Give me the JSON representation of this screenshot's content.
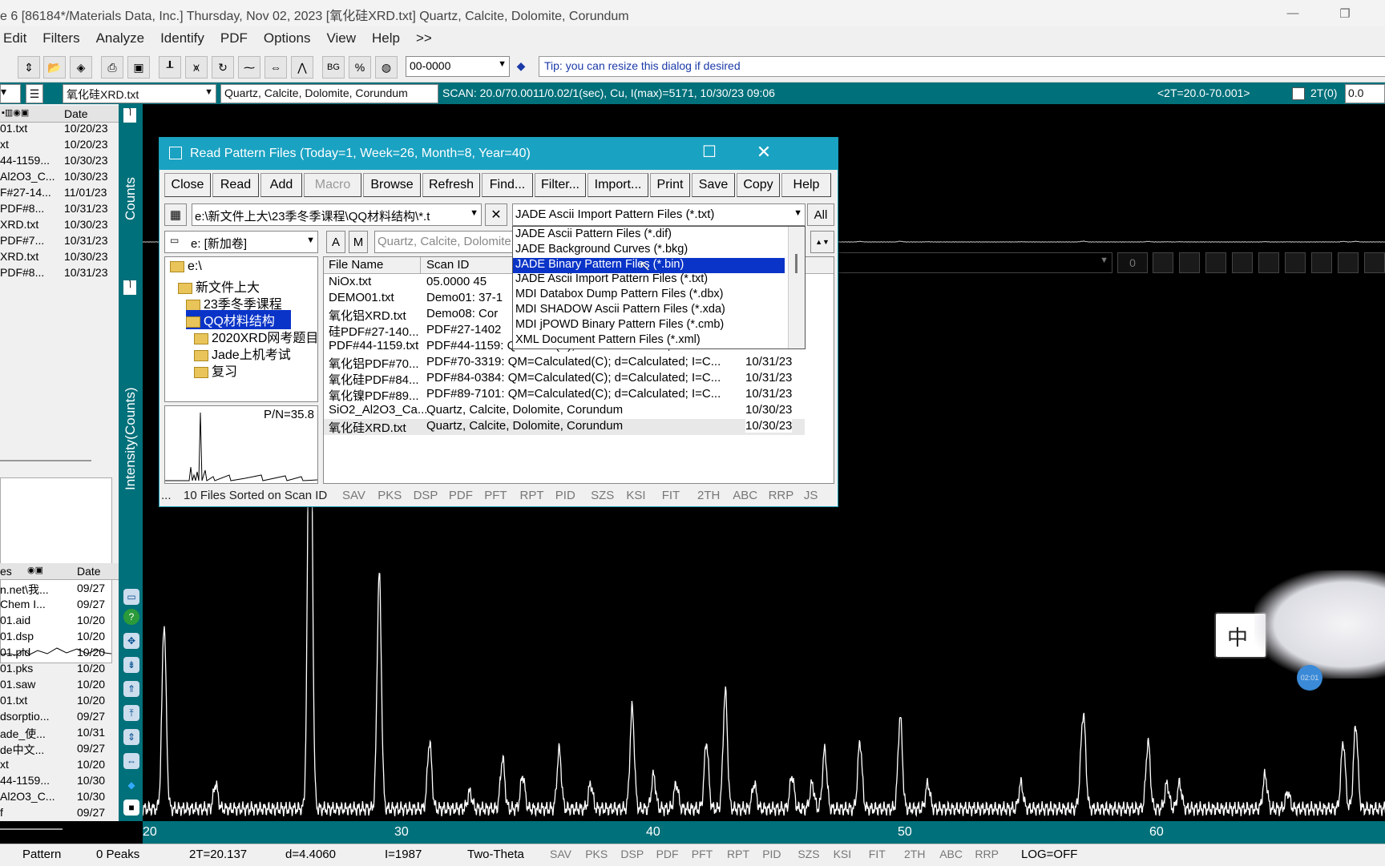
{
  "window": {
    "title": "e 6 [86184*/Materials Data, Inc.] Thursday, Nov 02, 2023 [氧化硅XRD.txt] Quartz, Calcite, Dolomite, Corundum",
    "minimize": "—",
    "restore": "❐"
  },
  "menu": [
    "Edit",
    "Filters",
    "Analyze",
    "Identify",
    "PDF",
    "Options",
    "View",
    "Help",
    ">>"
  ],
  "toolbar": {
    "pdf_number": "00-0000",
    "tip": "Tip: you can resize this dialog if desired",
    "icons": [
      "up-down-arrows-icon",
      "open-folder-icon",
      "clear-icon",
      "print-icon",
      "save-disk-icon",
      "bar-chart-icon",
      "peak-search-icon",
      "rotate-icon",
      "smooth-icon",
      "zoom-arrows-icon",
      "peak-icon",
      "bg-icon",
      "percent-icon",
      "globe-icon"
    ],
    "bg_label": "BG",
    "percent_label": "%"
  },
  "infobar": {
    "file": "氧化硅XRD.txt",
    "phases": "Quartz, Calcite, Dolomite, Corundum",
    "scan": "SCAN: 20.0/70.0011/0.02/1(sec), Cu, I(max)=5171, 10/30/23 09:06",
    "range": "<2T=20.0-70.001>",
    "twotheta_label": "2T(0)",
    "twotheta_value": "0.0"
  },
  "left_panel": {
    "header": "Date",
    "top_files": [
      {
        "name": "01.txt",
        "date": "10/20/23"
      },
      {
        "name": "xt",
        "date": "10/20/23"
      },
      {
        "name": "44-1159...",
        "date": "10/30/23"
      },
      {
        "name": "Al2O3_C...",
        "date": "10/30/23"
      },
      {
        "name": "F#27-14...",
        "date": "11/01/23"
      },
      {
        "name": "PDF#8...",
        "date": "10/31/23"
      },
      {
        "name": "XRD.txt",
        "date": "10/30/23"
      },
      {
        "name": "PDF#7...",
        "date": "10/31/23"
      },
      {
        "name": "XRD.txt",
        "date": "10/30/23"
      },
      {
        "name": "PDF#8...",
        "date": "10/31/23"
      }
    ],
    "bottom_header_name": "es",
    "bottom_header_date": "Date",
    "bottom_files": [
      {
        "name": "n.net\\我...",
        "date": "09/27"
      },
      {
        "name": "Chem I...",
        "date": "09/27"
      },
      {
        "name": "01.aid",
        "date": "10/20"
      },
      {
        "name": "01.dsp",
        "date": "10/20"
      },
      {
        "name": "01.pid",
        "date": "10/20"
      },
      {
        "name": "01.pks",
        "date": "10/20"
      },
      {
        "name": "01.saw",
        "date": "10/20"
      },
      {
        "name": "01.txt",
        "date": "10/20"
      },
      {
        "name": "dsorptio...",
        "date": "09/27"
      },
      {
        "name": "ade_使...",
        "date": "10/31"
      },
      {
        "name": "de中文...",
        "date": "09/27"
      },
      {
        "name": "xt",
        "date": "10/20"
      },
      {
        "name": "44-1159...",
        "date": "10/30"
      },
      {
        "name": "Al2O3_C...",
        "date": "10/30"
      },
      {
        "name": "f",
        "date": "09/27"
      }
    ]
  },
  "side_labels": {
    "counts": "Counts",
    "intensity": "Intensity(Counts)"
  },
  "plot": {
    "x_ticks": [
      "20",
      "30",
      "40",
      "50",
      "60"
    ],
    "x_range": [
      20,
      70
    ],
    "mini_value": "0",
    "badge": "02:01"
  },
  "dialog": {
    "title": "Read Pattern Files (Today=1, Week=26, Month=8, Year=40)",
    "buttons": [
      "Close",
      "Read",
      "Add",
      "Macro",
      "Browse",
      "Refresh",
      "Find...",
      "Filter...",
      "Import...",
      "Print",
      "Save",
      "Copy",
      "Help"
    ],
    "path": "e:\\新文件上大\\23季冬季课程\\QQ材料结构\\*.t",
    "filter_selected": "JADE Ascii Import Pattern Files (*.txt)",
    "all_label": "All",
    "drive": "e: [新加卷]",
    "a_label": "A",
    "m_label": "M",
    "scan_filter": "Quartz, Calcite, Dolomite",
    "tree": [
      {
        "label": "e:\\",
        "level": 0
      },
      {
        "label": "新文件上大",
        "level": 1
      },
      {
        "label": "23季冬季课程",
        "level": 2
      },
      {
        "label": "QQ材料结构",
        "level": 2,
        "selected": true
      },
      {
        "label": "2020XRD网考题目",
        "level": 3
      },
      {
        "label": "Jade上机考试",
        "level": 3
      },
      {
        "label": "复习",
        "level": 3
      }
    ],
    "pn": "P/N=35.8",
    "columns": {
      "name": "File Name",
      "scan": "Scan ID"
    },
    "files": [
      {
        "name": "NiOx.txt",
        "scan": "05.0000   45",
        "date": ""
      },
      {
        "name": "DEMO01.txt",
        "scan": "Demo01: 37-1",
        "date": ""
      },
      {
        "name": "氧化铝XRD.txt",
        "scan": "Demo08: Cor",
        "date": ""
      },
      {
        "name": "硅PDF#27-140...",
        "scan": "PDF#27-1402",
        "date": ""
      },
      {
        "name": "PDF#44-1159.txt",
        "scan": "PDF#44-1159: QM=Star(S); d=Diffractometer; I=Diff...",
        "date": "10/30/23"
      },
      {
        "name": "氧化铝PDF#70...",
        "scan": "PDF#70-3319: QM=Calculated(C); d=Calculated; I=C...",
        "date": "10/31/23"
      },
      {
        "name": "氧化硅PDF#84...",
        "scan": "PDF#84-0384: QM=Calculated(C); d=Calculated; I=C...",
        "date": "10/31/23"
      },
      {
        "name": "氧化镍PDF#89...",
        "scan": "PDF#89-7101: QM=Calculated(C); d=Calculated; I=C...",
        "date": "10/31/23"
      },
      {
        "name": "SiO2_Al2O3_Ca...",
        "scan": "Quartz, Calcite, Dolomite, Corundum",
        "date": "10/30/23"
      },
      {
        "name": "氧化硅XRD.txt",
        "scan": "Quartz, Calcite, Dolomite, Corundum",
        "date": "10/30/23"
      }
    ],
    "filter_options": [
      "JADE Ascii Pattern Files (*.dif)",
      "JADE Background Curves (*.bkg)",
      "JADE Binary Pattern Files (*.bin)",
      "JADE Ascii Import Pattern Files (*.txt)",
      "MDI Databox Dump Pattern Files (*.dbx)",
      "MDI SHADOW Ascii Pattern Files (*.xda)",
      "MDI jPOWD Binary Pattern Files (*.cmb)",
      "XML Document Pattern Files (*.xml)"
    ],
    "filter_highlight_index": 2,
    "status": "10 Files Sorted on Scan ID",
    "status_more": "...",
    "tabs": [
      "SAV",
      "PKS",
      "DSP",
      "PDF",
      "PFT",
      "RPT",
      "PID",
      "SZS",
      "KSI",
      "FIT",
      "2TH",
      "ABC",
      "RRP",
      "JS"
    ]
  },
  "statusbar": {
    "pattern": "Pattern",
    "peaks": "0 Peaks",
    "twotheta": "2T=20.137",
    "d": "d=4.4060",
    "i": "I=1987",
    "mode": "Two-Theta",
    "tabs": [
      "SAV",
      "PKS",
      "DSP",
      "PDF",
      "PFT",
      "RPT",
      "PID",
      "SZS",
      "KSI",
      "FIT",
      "2TH",
      "ABC",
      "RRP"
    ],
    "log": "LOG=OFF"
  },
  "colors": {
    "teal": "#00707a",
    "dialog_title": "#1aa2c2",
    "selection": "#0a34c8",
    "tip_text": "#1b3aa8"
  }
}
